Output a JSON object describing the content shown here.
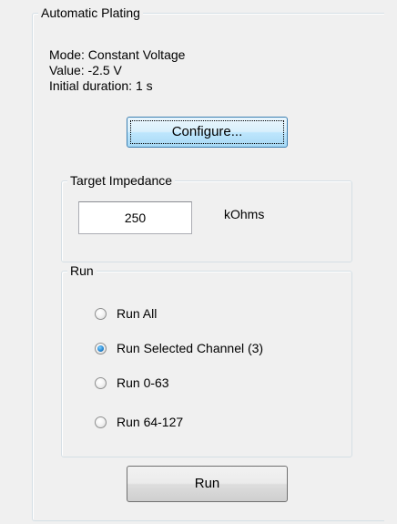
{
  "plating": {
    "title": "Automatic Plating",
    "mode_text": "Mode: Constant Voltage",
    "value_text": "Value: -2.5 V",
    "duration_text": "Initial duration: 1 s",
    "configure_label": "Configure..."
  },
  "impedance": {
    "title": "Target Impedance",
    "value": "250",
    "unit": "kOhms"
  },
  "run_group": {
    "title": "Run",
    "options": [
      {
        "label": "Run All",
        "checked": false
      },
      {
        "label": "Run Selected Channel (3)",
        "checked": true
      },
      {
        "label": "Run 0-63",
        "checked": false
      },
      {
        "label": "Run 64-127",
        "checked": false
      }
    ],
    "selected_index": 1
  },
  "run_button_label": "Run"
}
